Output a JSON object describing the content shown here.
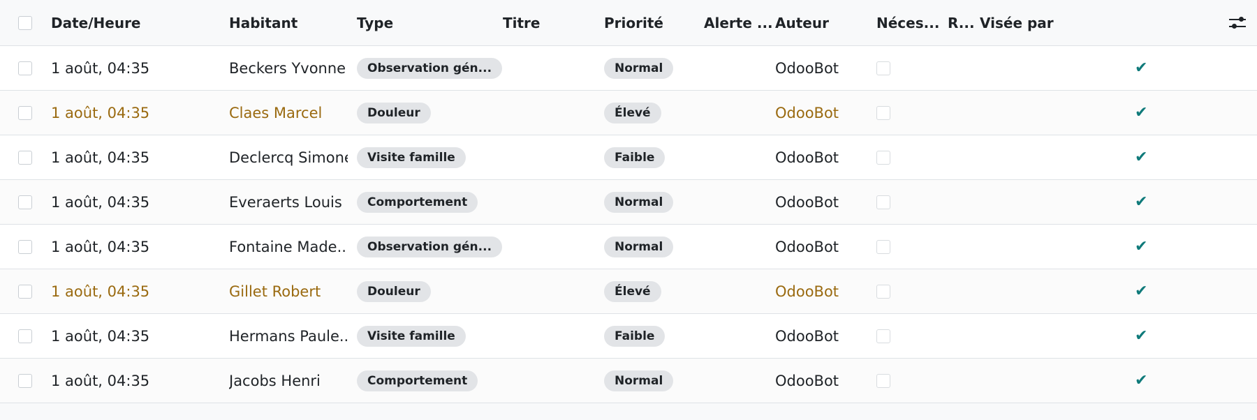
{
  "columns": {
    "date": "Date/Heure",
    "resident": "Habitant",
    "type": "Type",
    "title": "Titre",
    "priority": "Priorité",
    "alert": "Alerte ...",
    "author": "Auteur",
    "needs": "Néces...",
    "r": "R...",
    "seen_by": "Visée par"
  },
  "rows": [
    {
      "date": "1 août, 04:35",
      "resident": "Beckers Yvonne",
      "type": "Observation gén...",
      "title": "",
      "priority": "Normal",
      "author": "OdooBot",
      "highlight": false
    },
    {
      "date": "1 août, 04:35",
      "resident": "Claes Marcel",
      "type": "Douleur",
      "title": "",
      "priority": "Élevé",
      "author": "OdooBot",
      "highlight": true
    },
    {
      "date": "1 août, 04:35",
      "resident": "Declercq Simone",
      "type": "Visite famille",
      "title": "",
      "priority": "Faible",
      "author": "OdooBot",
      "highlight": false
    },
    {
      "date": "1 août, 04:35",
      "resident": "Everaerts Louis",
      "type": "Comportement",
      "title": "",
      "priority": "Normal",
      "author": "OdooBot",
      "highlight": false
    },
    {
      "date": "1 août, 04:35",
      "resident": "Fontaine Made...",
      "type": "Observation gén...",
      "title": "",
      "priority": "Normal",
      "author": "OdooBot",
      "highlight": false
    },
    {
      "date": "1 août, 04:35",
      "resident": "Gillet Robert",
      "type": "Douleur",
      "title": "",
      "priority": "Élevé",
      "author": "OdooBot",
      "highlight": true
    },
    {
      "date": "1 août, 04:35",
      "resident": "Hermans Paule...",
      "type": "Visite famille",
      "title": "",
      "priority": "Faible",
      "author": "OdooBot",
      "highlight": false
    },
    {
      "date": "1 août, 04:35",
      "resident": "Jacobs Henri",
      "type": "Comportement",
      "title": "",
      "priority": "Normal",
      "author": "OdooBot",
      "highlight": false
    }
  ],
  "icons": {
    "seen_check": "✔",
    "settings": "sliders-icon"
  },
  "colors": {
    "highlight_text": "#9a6a10",
    "check": "#0f7a7a"
  }
}
